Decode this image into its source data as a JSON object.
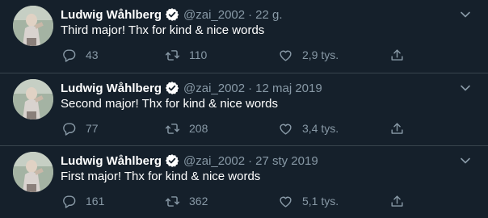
{
  "theme": {
    "background": "#15202b",
    "text": "#ffffff",
    "muted": "#8899a6",
    "divider": "#38444d",
    "verified": "#ffffff"
  },
  "tweets": [
    {
      "author_name": "Ludwig Wåhlberg",
      "handle": "@zai_2002",
      "separator": "·",
      "date": "22 g.",
      "text": "Third major! Thx for kind & nice words",
      "replies": "43",
      "retweets": "110",
      "likes": "2,9 tys.",
      "icons": {
        "reply": "reply-icon",
        "retweet": "retweet-icon",
        "like": "like-icon",
        "share": "share-icon"
      }
    },
    {
      "author_name": "Ludwig Wåhlberg",
      "handle": "@zai_2002",
      "separator": "·",
      "date": "12 maj 2019",
      "text": "Second major! Thx for kind & nice words",
      "replies": "77",
      "retweets": "208",
      "likes": "3,4 tys.",
      "icons": {
        "reply": "reply-icon",
        "retweet": "retweet-icon",
        "like": "like-icon",
        "share": "share-icon"
      }
    },
    {
      "author_name": "Ludwig Wåhlberg",
      "handle": "@zai_2002",
      "separator": "·",
      "date": "27 sty 2019",
      "text": "First major! Thx for kind & nice words",
      "replies": "161",
      "retweets": "362",
      "likes": "5,1 tys.",
      "icons": {
        "reply": "reply-icon",
        "retweet": "retweet-icon",
        "like": "like-icon",
        "share": "share-icon"
      }
    }
  ]
}
